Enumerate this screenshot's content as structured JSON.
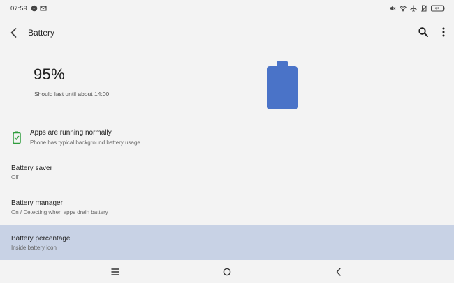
{
  "status_bar": {
    "time": "07:59",
    "left_icons": [
      "messenger-icon",
      "gmail-icon"
    ],
    "right_icons": [
      "mute-icon",
      "wifi-icon",
      "airplane-mode-icon",
      "no-sim-icon",
      "status-battery-icon"
    ],
    "battery_level": "95"
  },
  "app_bar": {
    "title": "Battery",
    "back_icon": "arrow-back-icon",
    "search_icon": "search-icon",
    "more_icon": "more-vertical-icon"
  },
  "battery": {
    "percent": "95%",
    "estimate": "Should last until about 14:00",
    "color": "#4a73c8"
  },
  "list": {
    "apps_status": {
      "title": "Apps are running normally",
      "subtitle": "Phone has typical background battery usage",
      "icon": "battery-ok-icon",
      "icon_color": "#2e9d3c"
    },
    "battery_saver": {
      "title": "Battery saver",
      "subtitle": "Off"
    },
    "battery_manager": {
      "title": "Battery manager",
      "subtitle": "On / Detecting when apps drain battery"
    },
    "battery_percentage": {
      "title": "Battery percentage",
      "subtitle": "Inside battery icon",
      "highlight_color": "#c8d2e5"
    }
  },
  "nav_bar": {
    "recents_icon": "recents-icon",
    "home_icon": "home-icon",
    "back_icon": "nav-back-icon"
  }
}
